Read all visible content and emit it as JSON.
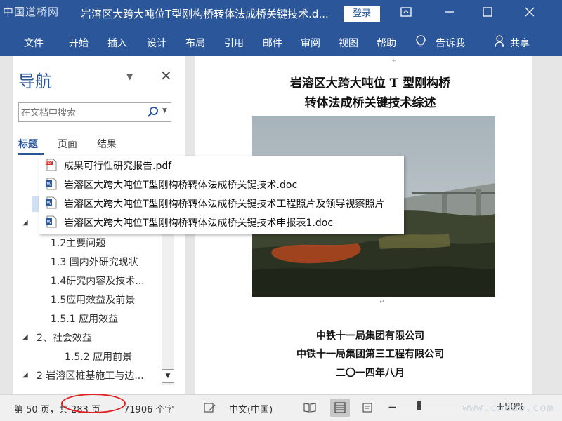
{
  "watermarks": {
    "top_left": "中国道桥网",
    "bottom_right": "www.cndao.com"
  },
  "titlebar": {
    "doc_title": "岩溶区大跨大吨位T型刚构桥转体法成桥关键技术.d...",
    "login_label": "登录",
    "icons": [
      "ribbon-display-icon",
      "minimize-icon",
      "maximize-icon",
      "close-icon"
    ]
  },
  "ribbon": {
    "tabs": [
      "文件",
      "开始",
      "插入",
      "设计",
      "布局",
      "引用",
      "邮件",
      "审阅",
      "视图",
      "帮助"
    ],
    "tellme": "告诉我",
    "share": "共享"
  },
  "nav": {
    "title": "导航",
    "search_placeholder": "在文档中搜索",
    "tabs": [
      "标题",
      "页面",
      "结果"
    ],
    "tree": [
      "1.2主要问题",
      "1.3 国内外研究现状",
      "1.4研究内容及技术...",
      "1.5应用效益及前景",
      "1.5.1 应用效益",
      "2、社会效益",
      "1.5.2 应用前景",
      "2 岩溶区桩基施工与边..."
    ]
  },
  "popup": {
    "files": [
      {
        "type": "pdf",
        "name": "成果可行性研究报告.pdf"
      },
      {
        "type": "doc",
        "name": "岩溶区大跨大吨位T型刚构桥转体法成桥关键技术.doc"
      },
      {
        "type": "doc",
        "name": "岩溶区大跨大吨位T型刚构桥转体法成桥关键技术工程照片及领导视察照片"
      },
      {
        "type": "doc",
        "name": "岩溶区大跨大吨位T型刚构桥转体法成桥关键技术申报表1.doc"
      }
    ]
  },
  "document": {
    "title_line1": "岩溶区大跨大吨位 T 型刚构桥",
    "title_line2": "转体法成桥关键技术综述",
    "org1": "中铁十一局集团有限公司",
    "org2": "中铁十一局集团第三工程有限公司",
    "date": "二〇一四年八月"
  },
  "status": {
    "page": "第 50 页，共 283 页",
    "words": "71906 个字",
    "language": "中文(中国)",
    "zoom_minus": "−",
    "zoom_plus": "+",
    "zoom": "50%",
    "zoom_level_percent": 50
  },
  "colors": {
    "accent": "#2b579a",
    "annotation": "#e02020",
    "selection": "#cfe0f5"
  }
}
